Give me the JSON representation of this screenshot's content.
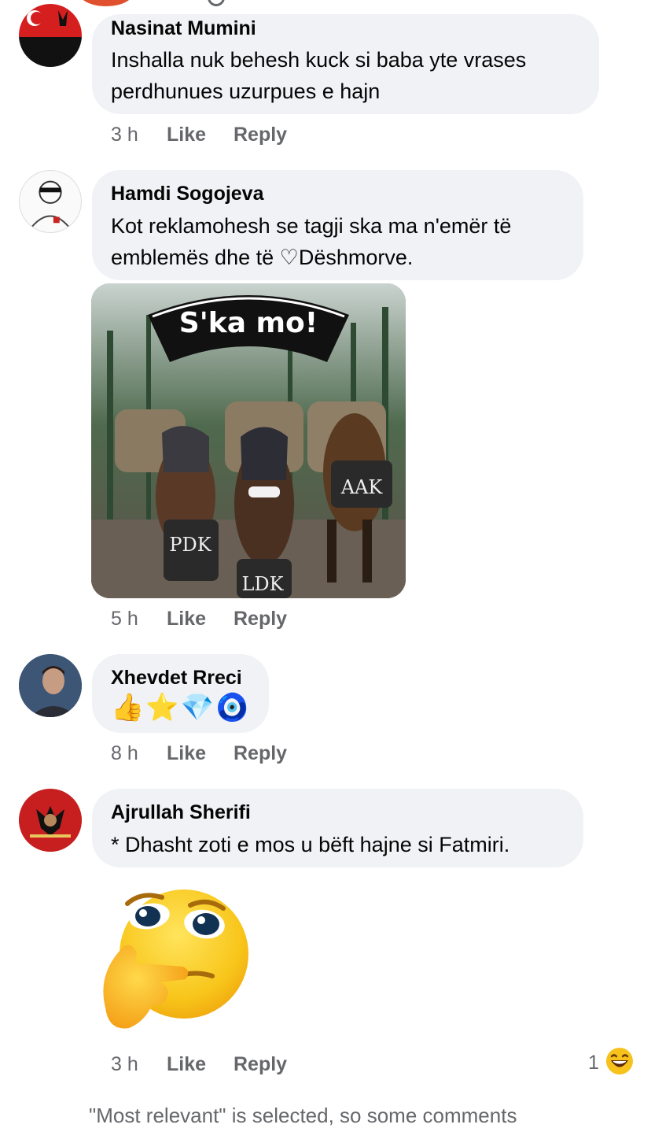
{
  "comments": [
    {
      "author": "Nasinat Mumini",
      "text_line1": "Inshalla nuk behesh kuck si baba yte vrases",
      "text_line2": "perdhunues uzurpues e hajn",
      "time": "3 h",
      "like": "Like",
      "reply": "Reply"
    },
    {
      "author": "Hamdi Sogojeva",
      "text_line1": "Kot reklamohesh se tagji ska ma n'emër të",
      "text_line2": "emblemës dhe të ♡Dëshmorve.",
      "time": "5 h",
      "like": "Like",
      "reply": "Reply",
      "image": {
        "banner": "S'ka mo!",
        "labels": [
          "PDK",
          "LDK",
          "AAK"
        ]
      }
    },
    {
      "author": "Xhevdet Rreci",
      "emojis": [
        "👍",
        "⭐",
        "💎",
        "🧿"
      ],
      "time": "8 h",
      "like": "Like",
      "reply": "Reply"
    },
    {
      "author": "Ajrullah Sherifi",
      "text_line1": "* Dhasht zoti e mos u bëft hajne si Fatmiri.",
      "sticker_icon": "thinking-face-icon",
      "time": "3 h",
      "like": "Like",
      "reply": "Reply",
      "reaction_count": "1",
      "reaction_icon": "laughing-face-icon"
    }
  ],
  "footer_note": "\"Most relevant\" is selected, so some comments",
  "colors": {
    "bubble": "#f0f2f5",
    "meta_text": "#65676b",
    "primary_text": "#050505"
  }
}
